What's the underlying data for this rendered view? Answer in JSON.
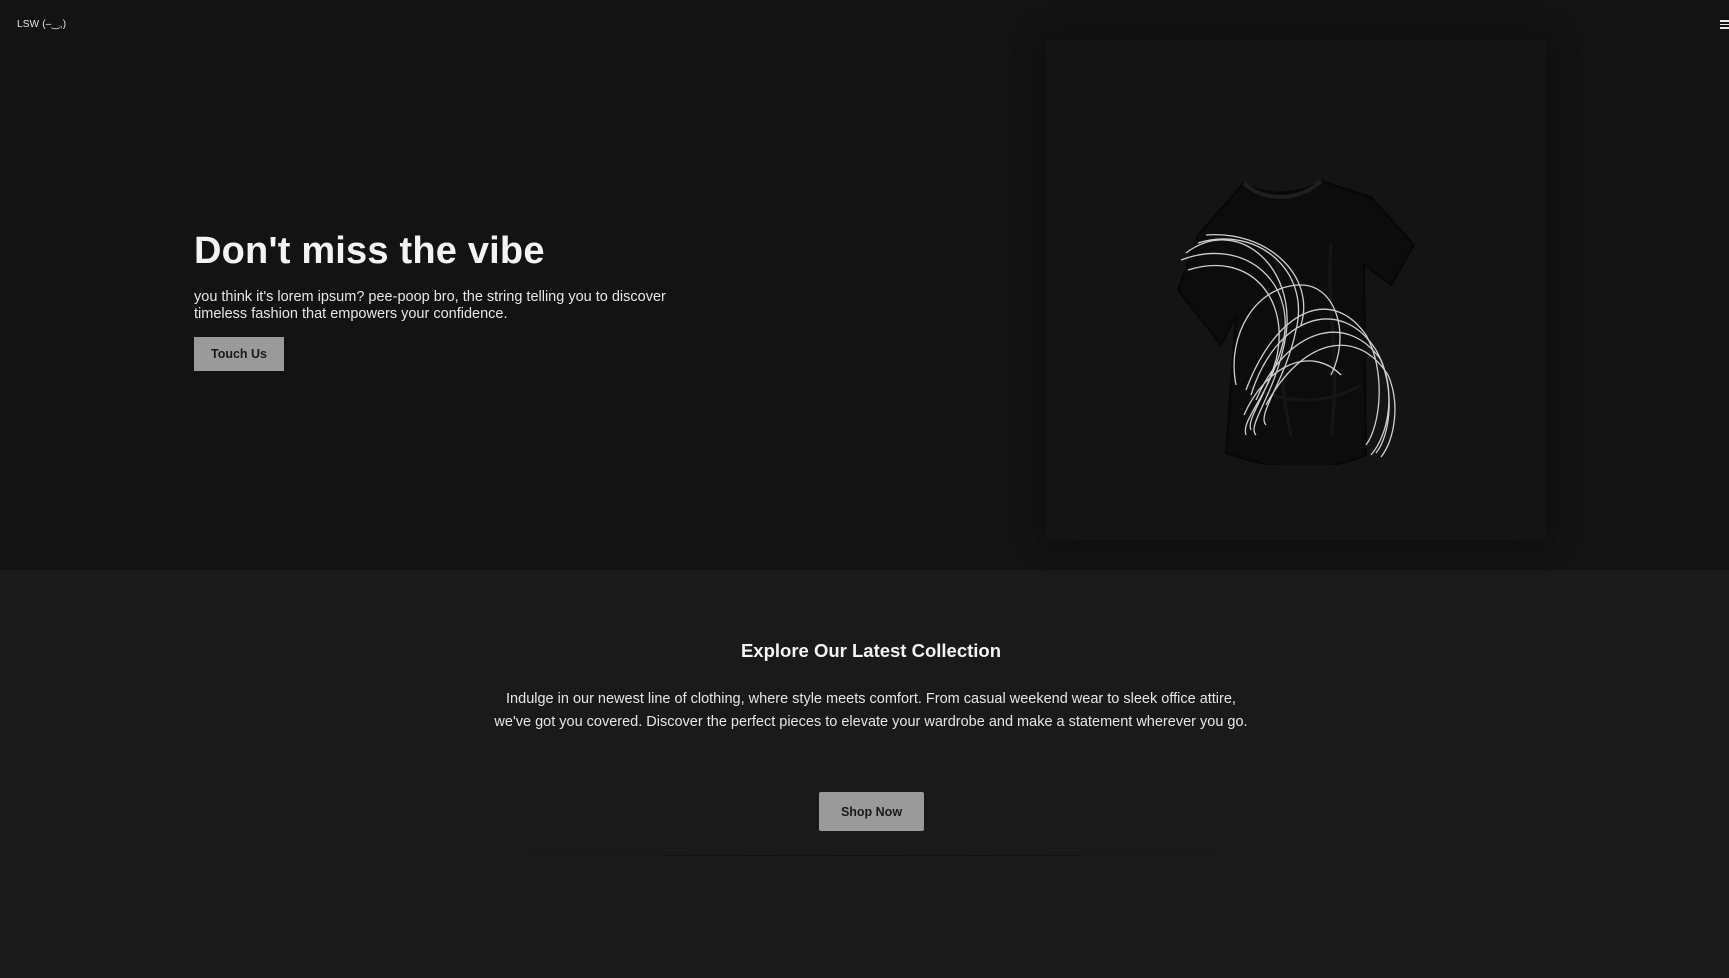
{
  "header": {
    "logo": "LSW (–‿,)",
    "menu_icon": "hamburger-menu-icon"
  },
  "hero": {
    "title": "Don't miss the vibe",
    "subtitle": "you think it's lorem ipsum? pee-poop bro, the string telling you to discover timeless fashion that empowers your confidence.",
    "cta_label": "Touch Us",
    "image": "black-tshirt-with-white-swirl-graphic"
  },
  "collection": {
    "title": "Explore Our Latest Collection",
    "body": "Indulge in our newest line of clothing, where style meets comfort. From casual weekend wear to sleek office attire, we've got you covered. Discover the perfect pieces to elevate your wardrobe and make a statement wherever you go.",
    "cta_label": "Shop Now"
  },
  "colors": {
    "hero_bg": "#131313",
    "page_bg": "#1a1a1a",
    "button_bg": "#9a9a9a",
    "text": "#f4f4f4"
  }
}
